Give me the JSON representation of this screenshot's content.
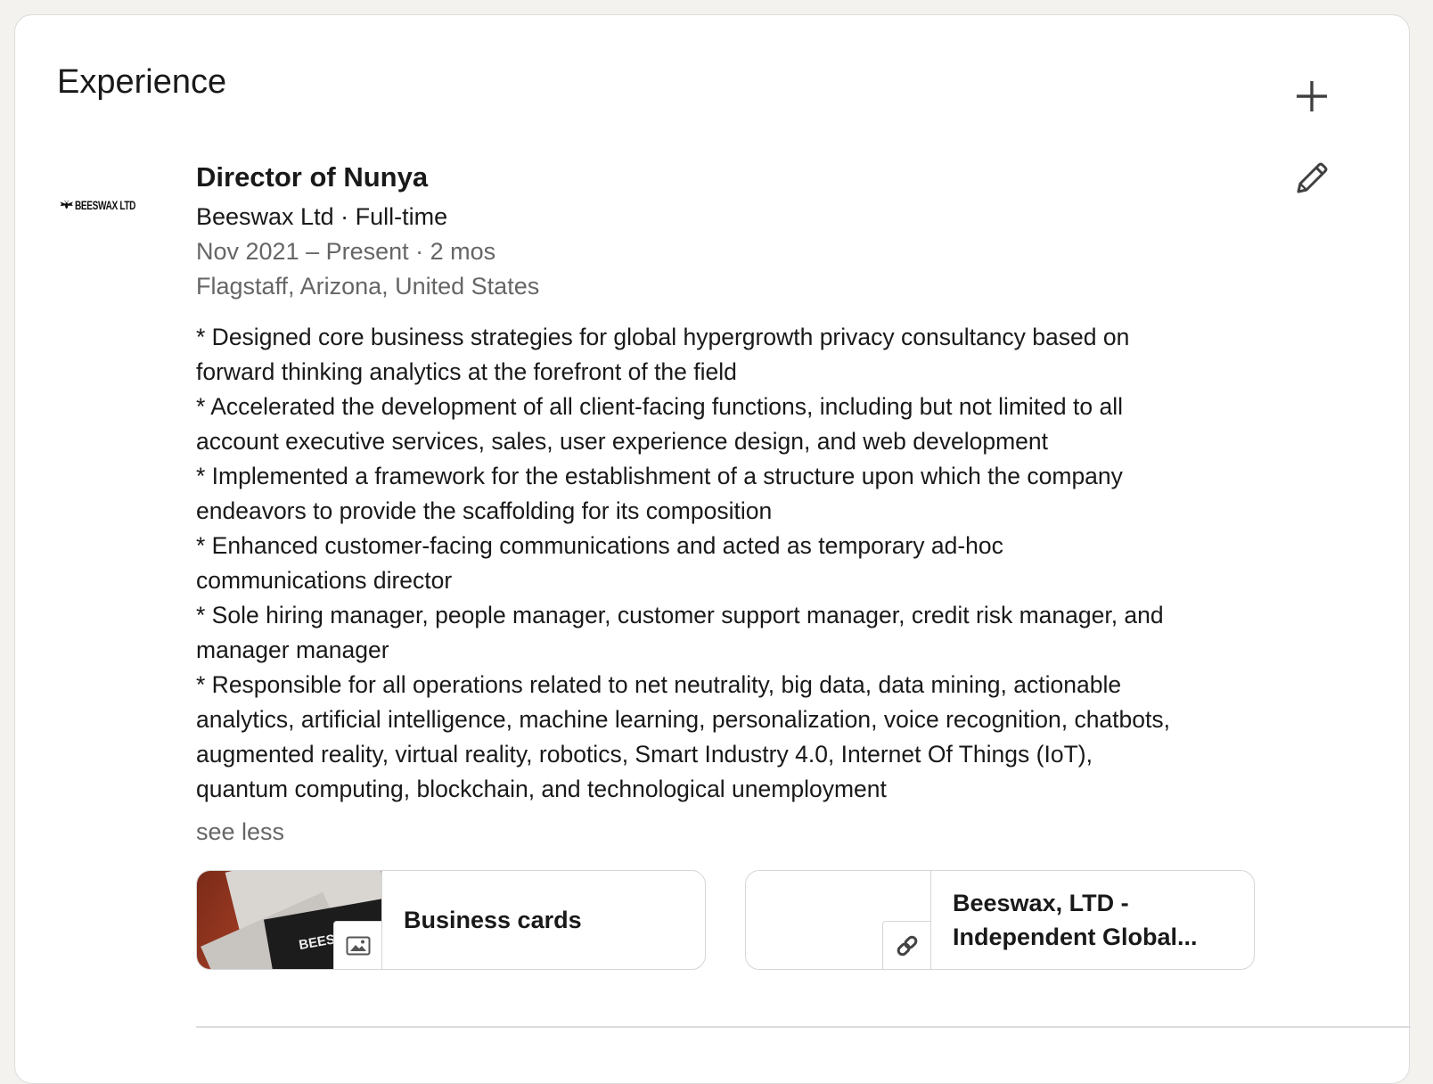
{
  "section": {
    "title": "Experience",
    "add_icon": "plus-icon",
    "edit_icon": "pencil-icon"
  },
  "experience": {
    "logo_text": "BEESWAX LTD",
    "title": "Director of Nunya",
    "company_line": "Beeswax Ltd · Full-time",
    "dates": "Nov 2021 – Present · 2 mos",
    "location": "Flagstaff, Arizona, United States",
    "description_lines": [
      "* Designed core business strategies for global hypergrowth privacy consultancy based on",
      "forward thinking analytics at the forefront of the field",
      "* Accelerated the development of all client-facing functions, including but not limited to all",
      "account executive services, sales, user experience design, and web development",
      "* Implemented a framework for the establishment of a structure upon which the company",
      "endeavors to provide the scaffolding for its composition",
      "* Enhanced customer-facing communications and acted as temporary ad-hoc",
      "communications director",
      "* Sole hiring manager, people manager, customer support manager, credit risk manager, and",
      "manager manager",
      "* Responsible for all operations related to net neutrality, big data, data mining, actionable",
      "analytics, artificial intelligence, machine learning, personalization, voice recognition, chatbots,",
      "augmented reality, virtual reality, robotics, Smart Industry 4.0, Internet Of Things (IoT),",
      "quantum computing, blockchain, and technological unemployment"
    ],
    "see_less": "see less",
    "media": [
      {
        "label": "Business cards",
        "thumb_text": "BEESW",
        "badge_icon": "image-icon"
      },
      {
        "label_line1": "Beeswax, LTD -",
        "label_line2": "Independent Global...",
        "badge_icon": "link-icon"
      }
    ]
  },
  "colors": {
    "background": "#f3f2ef",
    "card": "#ffffff",
    "secondary_text": "#666666",
    "primary_text": "#191919"
  }
}
